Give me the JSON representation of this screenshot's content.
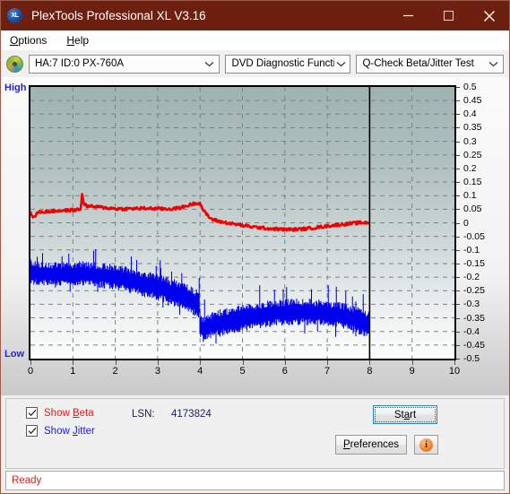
{
  "window": {
    "title": "PlexTools Professional XL V3.16",
    "logo_text": "XL",
    "minimize_icon": "minimize-icon",
    "maximize_icon": "maximize-icon",
    "close_icon": "close-icon"
  },
  "menu": {
    "items": [
      {
        "label": "Options",
        "accel": "O"
      },
      {
        "label": "Help",
        "accel": "H"
      }
    ]
  },
  "toolbar": {
    "disc_icon": "disc-icon",
    "drive": {
      "value": "HA:7 ID:0  PX-760A",
      "caret": "chevron-down-icon"
    },
    "function": {
      "value": "DVD Diagnostic Functions",
      "caret": "chevron-down-icon"
    },
    "test": {
      "value": "Q-Check Beta/Jitter Test",
      "caret": "chevron-down-icon"
    }
  },
  "chart_data": {
    "type": "line",
    "title": "Q-Check Beta/Jitter Test",
    "xlabel": "",
    "ylabel": "",
    "xlim": [
      0,
      10
    ],
    "ylim": [
      -0.5,
      0.5
    ],
    "xticks": [
      0,
      1,
      2,
      3,
      4,
      5,
      6,
      7,
      8,
      9,
      10
    ],
    "yticks": [
      0.5,
      0.45,
      0.4,
      0.35,
      0.3,
      0.25,
      0.2,
      0.15,
      0.1,
      0.05,
      0,
      -0.05,
      -0.1,
      -0.15,
      -0.2,
      -0.25,
      -0.3,
      -0.35,
      -0.4,
      -0.45,
      -0.5
    ],
    "grid": true,
    "grid_style": "dashed",
    "axis_top_label": "High",
    "axis_bottom_label": "Low",
    "data_end_marker_x": 8,
    "legend_position": "external-checkboxes",
    "series": [
      {
        "name": "Beta",
        "color": "#ee0000",
        "x": [
          0.0,
          0.08,
          0.16,
          0.24,
          0.32,
          0.45,
          0.6,
          0.75,
          0.9,
          1.05,
          1.18,
          1.22,
          1.26,
          1.32,
          1.45,
          1.6,
          1.8,
          2.0,
          2.2,
          2.4,
          2.6,
          2.8,
          3.0,
          3.2,
          3.4,
          3.6,
          3.8,
          3.95,
          4.0,
          4.1,
          4.25,
          4.45,
          4.7,
          5.0,
          5.3,
          5.6,
          5.9,
          6.2,
          6.5,
          6.8,
          7.1,
          7.4,
          7.6,
          7.8,
          7.95,
          8.0
        ],
        "y": [
          0.04,
          0.018,
          0.036,
          0.04,
          0.041,
          0.042,
          0.044,
          0.045,
          0.046,
          0.047,
          0.05,
          0.105,
          0.072,
          0.062,
          0.06,
          0.058,
          0.055,
          0.052,
          0.051,
          0.052,
          0.053,
          0.053,
          0.052,
          0.051,
          0.052,
          0.058,
          0.068,
          0.074,
          0.072,
          0.04,
          0.015,
          0.005,
          -0.002,
          -0.01,
          -0.016,
          -0.021,
          -0.024,
          -0.025,
          -0.022,
          -0.016,
          -0.01,
          -0.005,
          -0.002,
          0.0,
          0.001,
          0.001
        ]
      },
      {
        "name": "Jitter",
        "color": "#0000ee",
        "band": true,
        "x": [
          0.0,
          0.1,
          0.25,
          0.45,
          0.65,
          0.85,
          1.05,
          1.25,
          1.45,
          1.65,
          1.85,
          2.05,
          2.25,
          2.45,
          2.65,
          2.85,
          3.05,
          3.25,
          3.45,
          3.65,
          3.85,
          3.98,
          4.0,
          4.05,
          4.2,
          4.4,
          4.6,
          4.85,
          5.1,
          5.35,
          5.6,
          5.85,
          6.1,
          6.35,
          6.6,
          6.85,
          7.1,
          7.35,
          7.6,
          7.8,
          7.95,
          8.0
        ],
        "y_upper": [
          -0.14,
          -0.148,
          -0.15,
          -0.152,
          -0.15,
          -0.152,
          -0.15,
          -0.148,
          -0.152,
          -0.155,
          -0.158,
          -0.162,
          -0.168,
          -0.175,
          -0.182,
          -0.19,
          -0.198,
          -0.208,
          -0.218,
          -0.232,
          -0.248,
          -0.258,
          -0.33,
          -0.348,
          -0.34,
          -0.33,
          -0.322,
          -0.315,
          -0.308,
          -0.3,
          -0.294,
          -0.29,
          -0.288,
          -0.286,
          -0.287,
          -0.29,
          -0.295,
          -0.302,
          -0.312,
          -0.322,
          -0.33,
          -0.332
        ],
        "y_lower": [
          -0.215,
          -0.222,
          -0.224,
          -0.226,
          -0.225,
          -0.226,
          -0.225,
          -0.224,
          -0.228,
          -0.232,
          -0.236,
          -0.242,
          -0.248,
          -0.256,
          -0.264,
          -0.272,
          -0.282,
          -0.292,
          -0.304,
          -0.318,
          -0.334,
          -0.344,
          -0.42,
          -0.432,
          -0.424,
          -0.414,
          -0.406,
          -0.398,
          -0.39,
          -0.382,
          -0.376,
          -0.372,
          -0.37,
          -0.368,
          -0.369,
          -0.372,
          -0.378,
          -0.386,
          -0.396,
          -0.406,
          -0.414,
          -0.416
        ]
      }
    ]
  },
  "controls": {
    "show_beta": {
      "label_pre": "Show ",
      "accel": "B",
      "label_post": "eta",
      "checked": true,
      "color": "#e01b1b"
    },
    "show_jitter": {
      "label_pre": "Show ",
      "accel": "J",
      "label_post": "itter",
      "checked": true,
      "color": "#1b1be0"
    },
    "lsn_label": "LSN:",
    "lsn_value": "4173824",
    "start_pre": "St",
    "start_accel": "a",
    "start_post": "rt",
    "prefs_pre": "",
    "prefs_accel": "P",
    "prefs_post": "references",
    "info_glyph": "i"
  },
  "status": {
    "text": "Ready"
  }
}
